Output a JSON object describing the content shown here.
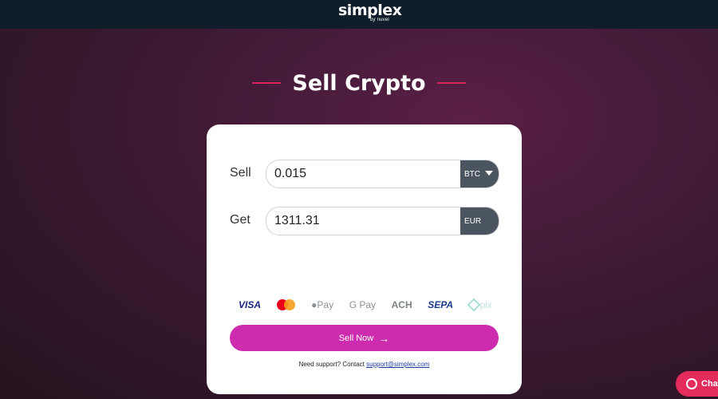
{
  "header": {
    "logo_text": "simplex",
    "logo_by": "by nuvei"
  },
  "page": {
    "title": "Sell Crypto"
  },
  "form": {
    "sell_label": "Sell",
    "sell_value": "0.015",
    "sell_currency": "BTC",
    "get_label": "Get",
    "get_value": "1311.31",
    "get_currency": "EUR"
  },
  "payment_methods": {
    "visa": "VISA",
    "mastercard": "mastercard",
    "apple_pay": "Pay",
    "google_pay": "G Pay",
    "ach": "ACH",
    "sepa": "SEPA",
    "pix": "pix"
  },
  "actions": {
    "sell_now": "Sell Now",
    "arrow": "→"
  },
  "support": {
    "text": "Need support? Contact",
    "email": "support@simplex.com"
  },
  "chat": {
    "label": "Chat"
  },
  "colors": {
    "accent": "#cd2cae",
    "title_line": "#d6235c",
    "chat": "#e32c5c",
    "topbar": "#0f1e2a"
  }
}
